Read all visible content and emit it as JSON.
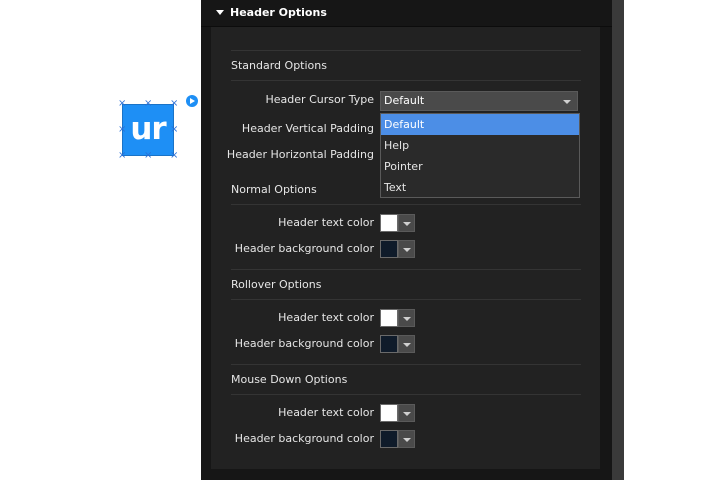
{
  "canvas": {
    "widget_text": "ur",
    "colors": {
      "widget_fill": "#1e8ff5",
      "handle": "#2a6fd6"
    }
  },
  "panel": {
    "title": "Header Options",
    "colors": {
      "background": "#161616",
      "body": "#222222",
      "accent": "#4c8ee6"
    }
  },
  "standard": {
    "title": "Standard Options",
    "cursor_label": "Header Cursor Type",
    "cursor_value": "Default",
    "cursor_options": [
      "Default",
      "Help",
      "Pointer",
      "Text"
    ],
    "vpad_label": "Header Vertical Padding",
    "hpad_label": "Header Horizontal Padding"
  },
  "normal": {
    "title": "Normal Options",
    "text_color_label": "Header text color",
    "text_color": "#ffffff",
    "bg_color_label": "Header background color",
    "bg_color": "#0f1b2a"
  },
  "rollover": {
    "title": "Rollover Options",
    "text_color_label": "Header text color",
    "text_color": "#ffffff",
    "bg_color_label": "Header background color",
    "bg_color": "#0f1b2a"
  },
  "mousedown": {
    "title": "Mouse Down Options",
    "text_color_label": "Header text color",
    "text_color": "#ffffff",
    "bg_color_label": "Header background color",
    "bg_color": "#0f1b2a"
  }
}
